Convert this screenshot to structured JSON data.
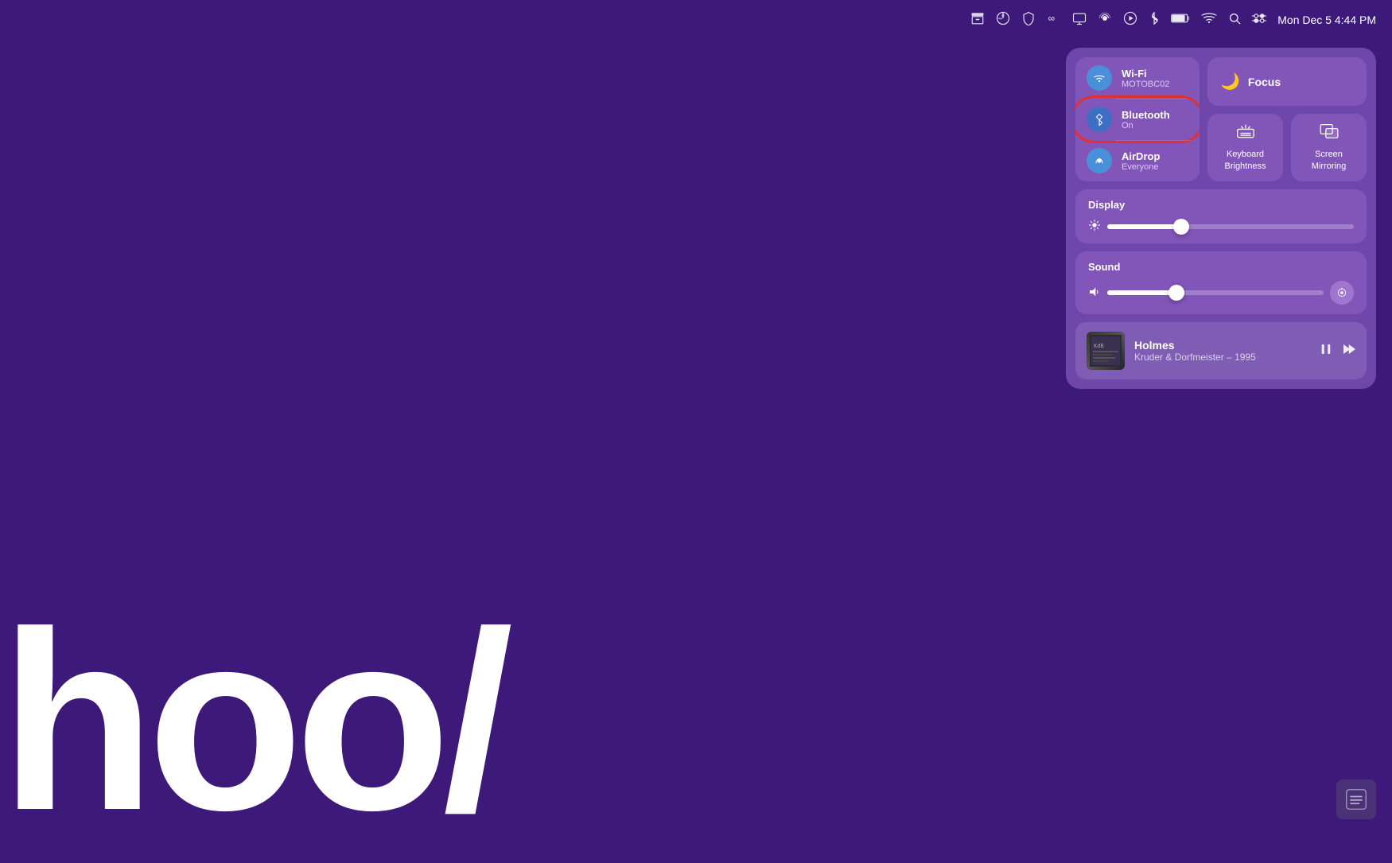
{
  "menubar": {
    "time": "Mon Dec 5  4:44 PM",
    "icons": [
      {
        "name": "archive-icon",
        "symbol": "📥"
      },
      {
        "name": "maps-icon",
        "symbol": "🗺"
      },
      {
        "name": "shield-icon",
        "symbol": "🛡"
      },
      {
        "name": "creative-cloud-icon",
        "symbol": "☁"
      },
      {
        "name": "display-icon",
        "symbol": "🖥"
      },
      {
        "name": "podcast-icon",
        "symbol": "🎙"
      },
      {
        "name": "media-icon",
        "symbol": "▶"
      },
      {
        "name": "bluetooth-icon",
        "symbol": "✲"
      },
      {
        "name": "battery-icon",
        "symbol": "🔋"
      },
      {
        "name": "wifi-icon",
        "symbol": "wifi"
      },
      {
        "name": "search-icon",
        "symbol": "🔍"
      },
      {
        "name": "control-center-icon",
        "symbol": "⚙"
      }
    ]
  },
  "control_center": {
    "connectivity": {
      "items": [
        {
          "id": "wifi",
          "title": "Wi-Fi",
          "subtitle": "MOTOBC02",
          "icon_type": "wifi"
        },
        {
          "id": "bluetooth",
          "title": "Bluetooth",
          "subtitle": "On",
          "icon_type": "bluetooth",
          "highlighted": true
        },
        {
          "id": "airdrop",
          "title": "AirDrop",
          "subtitle": "Everyone",
          "icon_type": "airdrop"
        }
      ]
    },
    "focus": {
      "label": "Focus",
      "icon": "🌙"
    },
    "keyboard_brightness": {
      "label": "Keyboard\nBrightness",
      "icon": "☀"
    },
    "screen_mirroring": {
      "label": "Screen\nMirroring",
      "icon": "⬛"
    },
    "display": {
      "title": "Display",
      "brightness_percent": 30
    },
    "sound": {
      "title": "Sound",
      "volume_percent": 32
    },
    "now_playing": {
      "title": "Holmes",
      "artist": "Kruder & Dorfmeister – 1995",
      "album_art_text": "KdB"
    }
  },
  "desktop": {
    "text": "hoo/"
  }
}
